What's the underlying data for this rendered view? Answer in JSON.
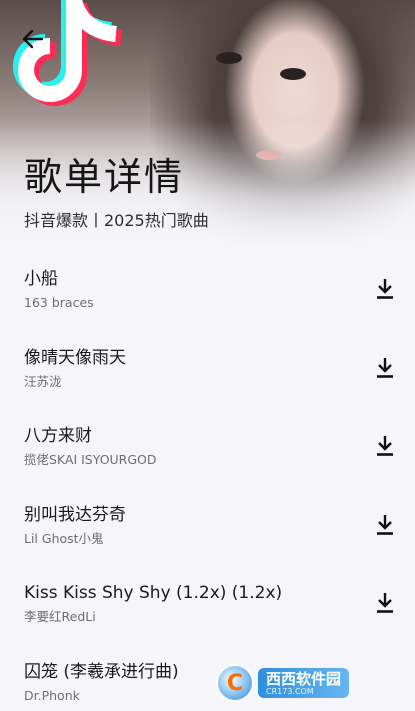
{
  "header": {
    "title": "歌单详情",
    "subtitle": "抖音爆款丨2025热门歌曲"
  },
  "icons": {
    "back": "arrow-left-icon",
    "download": "download-icon",
    "logo": "tiktok-logo-icon"
  },
  "colors": {
    "background": "#f6f6fa",
    "logo_cyan": "#25f4ee",
    "logo_red": "#fe2c55",
    "logo_white": "#ffffff"
  },
  "songs": [
    {
      "title": "小船",
      "artist": "163 braces"
    },
    {
      "title": "像晴天像雨天",
      "artist": "汪苏泷"
    },
    {
      "title": "八方来财",
      "artist": "揽佬SKAI ISYOURGOD"
    },
    {
      "title": "别叫我达芬奇",
      "artist": "Lil Ghost小鬼"
    },
    {
      "title": "Kiss Kiss Shy Shy (1.2x) (1.2x)",
      "artist": "李要红RedLi"
    },
    {
      "title": "囚笼 (李羲承进行曲)",
      "artist": "Dr.Phonk"
    }
  ],
  "watermark": {
    "logo_letter": "C",
    "name": "西西软件园",
    "domain": "CR173.COM"
  }
}
